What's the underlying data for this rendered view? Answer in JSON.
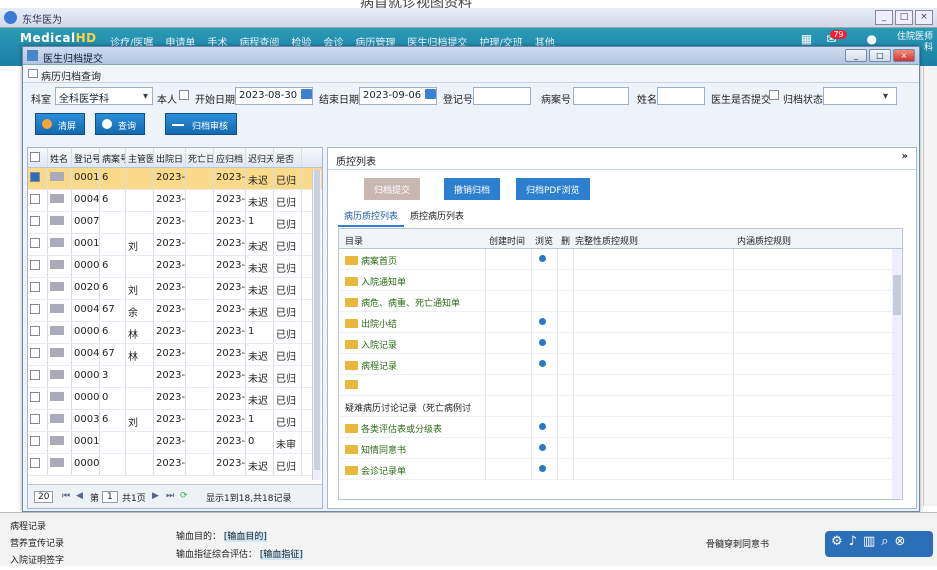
{
  "caption": "病首就诊视图资料",
  "os_window": {
    "title": "东华医为"
  },
  "app": {
    "logo": "Medical",
    "logo_suffix": "HD",
    "menu": [
      "诊疗/医嘱",
      "申请单",
      "手术",
      "病程查阅",
      "检验",
      "会诊",
      "病历管理",
      "医生归档提交",
      "护理/交班",
      "其他"
    ],
    "notif_count": "79",
    "user_line1": "住院医师",
    "user_line2": "科"
  },
  "dialog": {
    "title": "医生归档提交",
    "sub_title": "病历归档查询",
    "filters": {
      "dept_label": "科室",
      "dept_value": "全科医学科",
      "self_label": "本人",
      "start_label": "开始日期",
      "start_value": "2023-08-30",
      "end_label": "结束日期",
      "end_value": "2023-09-06",
      "reg_label": "登记号",
      "case_label": "病案号",
      "name_label": "姓名",
      "submitted_label": "医生是否提交",
      "status_label": "归档状态"
    },
    "buttons": {
      "clear": "清屏",
      "query": "查询",
      "archive_audit": "归档审核"
    },
    "table": {
      "headers": [
        "姓名",
        "登记号",
        "病案号",
        "主管医",
        "出院日",
        "死亡日",
        "应归档",
        "迟归天",
        "是否"
      ],
      "rows": [
        {
          "reg": "0001",
          "case": "6",
          "doc": "",
          "out": "2023-",
          "due": "2023-",
          "late": "未迟",
          "st": "已归"
        },
        {
          "reg": "0004",
          "case": "6",
          "doc": "",
          "out": "2023-",
          "due": "2023-",
          "late": "未迟",
          "st": "已归"
        },
        {
          "reg": "0007",
          "case": "",
          "doc": "",
          "out": "2023-",
          "due": "2023-",
          "late": "1",
          "st": "已归"
        },
        {
          "reg": "0001",
          "case": "",
          "doc": "刘",
          "out": "2023-",
          "due": "2023-",
          "late": "未迟",
          "st": "已归"
        },
        {
          "reg": "0000",
          "case": "6",
          "doc": "",
          "out": "2023-",
          "due": "2023-",
          "late": "未迟",
          "st": "已归"
        },
        {
          "reg": "0020",
          "case": "6",
          "doc": "刘",
          "out": "2023-",
          "due": "2023-",
          "late": "未迟",
          "st": "已归"
        },
        {
          "reg": "0004",
          "case": "67",
          "doc": "余",
          "out": "2023-",
          "due": "2023-",
          "late": "未迟",
          "st": "已归"
        },
        {
          "reg": "0000",
          "case": "6",
          "doc": "林",
          "out": "2023-",
          "due": "2023-",
          "late": "1",
          "st": "已归"
        },
        {
          "reg": "0004",
          "case": "67",
          "doc": "林",
          "out": "2023-",
          "due": "2023-",
          "late": "未迟",
          "st": "已归"
        },
        {
          "reg": "0000",
          "case": "3",
          "doc": "",
          "out": "2023-",
          "due": "2023-",
          "late": "未迟",
          "st": "已归"
        },
        {
          "reg": "0000",
          "case": "0",
          "doc": "",
          "out": "2023-",
          "due": "2023-",
          "late": "未迟",
          "st": "已归"
        },
        {
          "reg": "0003",
          "case": "6",
          "doc": "刘",
          "out": "2023-",
          "due": "2023-",
          "late": "1",
          "st": "已归"
        },
        {
          "reg": "0001",
          "case": "",
          "doc": "",
          "out": "2023-",
          "due": "2023-",
          "late": "0",
          "st": "未审"
        },
        {
          "reg": "0000",
          "case": "",
          "doc": "",
          "out": "2023-",
          "due": "2023-",
          "late": "未迟",
          "st": "已归"
        }
      ]
    },
    "pager": {
      "size": "20",
      "page": "1",
      "total_pages": "共1页",
      "summary": "显示1到18,共18记录"
    },
    "right": {
      "title": "质控列表",
      "btn_submit": "归档提交",
      "btn_cancel": "撤销归档",
      "btn_pdf": "归档PDF浏览",
      "tabs": [
        "病历质控列表",
        "质控病历列表"
      ],
      "tree_headers": [
        "目录",
        "创建时间",
        "浏览",
        "删",
        "完整性质控规则",
        "内涵质控规则"
      ],
      "items": [
        {
          "name": "病案首页",
          "dot": true
        },
        {
          "name": "入院通知单",
          "dot": false
        },
        {
          "name": "病危、病重、死亡通知单",
          "dot": false
        },
        {
          "name": "出院小结",
          "dot": true
        },
        {
          "name": "入院记录",
          "dot": true
        },
        {
          "name": "病程记录",
          "dot": true
        },
        {
          "name": "",
          "dot": false
        },
        {
          "name": "疑难病历讨论记录（死亡病例讨",
          "dot": false
        },
        {
          "name": "各类评估表或分级表",
          "dot": true
        },
        {
          "name": "知情同意书",
          "dot": true
        },
        {
          "name": "会诊记录单",
          "dot": true
        }
      ]
    }
  },
  "bottom": {
    "left1": "病程记录",
    "left2": "营养宣传记录",
    "left3": "入院证明签字",
    "mid1": "输血目的：",
    "mid1b": "[输血目的]",
    "mid2": "输血指征综合评估：",
    "mid2b": "[输血指征]",
    "right1": "骨髓穿刺同意书"
  }
}
